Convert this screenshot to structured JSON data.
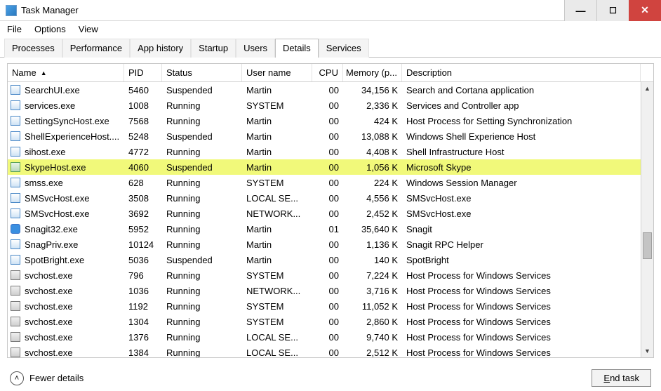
{
  "window": {
    "title": "Task Manager",
    "buttons": {
      "min": "—",
      "max": "☐",
      "close": "✕"
    }
  },
  "menu": {
    "items": [
      "File",
      "Options",
      "View"
    ]
  },
  "tabs": {
    "items": [
      "Processes",
      "Performance",
      "App history",
      "Startup",
      "Users",
      "Details",
      "Services"
    ],
    "active": "Details"
  },
  "columns": {
    "name": "Name",
    "pid": "PID",
    "status": "Status",
    "user": "User name",
    "cpu": "CPU",
    "mem": "Memory (p...",
    "desc": "Description",
    "sort_indicator": "▲"
  },
  "rows": [
    {
      "icon": "app",
      "name": "SearchUI.exe",
      "pid": "5460",
      "status": "Suspended",
      "user": "Martin",
      "cpu": "00",
      "mem": "34,156 K",
      "desc": "Search and Cortana application",
      "hl": false
    },
    {
      "icon": "app",
      "name": "services.exe",
      "pid": "1008",
      "status": "Running",
      "user": "SYSTEM",
      "cpu": "00",
      "mem": "2,336 K",
      "desc": "Services and Controller app",
      "hl": false
    },
    {
      "icon": "app",
      "name": "SettingSyncHost.exe",
      "pid": "7568",
      "status": "Running",
      "user": "Martin",
      "cpu": "00",
      "mem": "424 K",
      "desc": "Host Process for Setting Synchronization",
      "hl": false
    },
    {
      "icon": "app",
      "name": "ShellExperienceHost....",
      "pid": "5248",
      "status": "Suspended",
      "user": "Martin",
      "cpu": "00",
      "mem": "13,088 K",
      "desc": "Windows Shell Experience Host",
      "hl": false
    },
    {
      "icon": "app",
      "name": "sihost.exe",
      "pid": "4772",
      "status": "Running",
      "user": "Martin",
      "cpu": "00",
      "mem": "4,408 K",
      "desc": "Shell Infrastructure Host",
      "hl": false
    },
    {
      "icon": "alt",
      "name": "SkypeHost.exe",
      "pid": "4060",
      "status": "Suspended",
      "user": "Martin",
      "cpu": "00",
      "mem": "1,056 K",
      "desc": "Microsoft Skype",
      "hl": true
    },
    {
      "icon": "app",
      "name": "smss.exe",
      "pid": "628",
      "status": "Running",
      "user": "SYSTEM",
      "cpu": "00",
      "mem": "224 K",
      "desc": "Windows Session Manager",
      "hl": false
    },
    {
      "icon": "app",
      "name": "SMSvcHost.exe",
      "pid": "3508",
      "status": "Running",
      "user": "LOCAL SE...",
      "cpu": "00",
      "mem": "4,556 K",
      "desc": "SMSvcHost.exe",
      "hl": false
    },
    {
      "icon": "app",
      "name": "SMSvcHost.exe",
      "pid": "3692",
      "status": "Running",
      "user": "NETWORK...",
      "cpu": "00",
      "mem": "2,452 K",
      "desc": "SMSvcHost.exe",
      "hl": false
    },
    {
      "icon": "blue",
      "name": "Snagit32.exe",
      "pid": "5952",
      "status": "Running",
      "user": "Martin",
      "cpu": "01",
      "mem": "35,640 K",
      "desc": "Snagit",
      "hl": false
    },
    {
      "icon": "app",
      "name": "SnagPriv.exe",
      "pid": "10124",
      "status": "Running",
      "user": "Martin",
      "cpu": "00",
      "mem": "1,136 K",
      "desc": "Snagit RPC Helper",
      "hl": false
    },
    {
      "icon": "app",
      "name": "SpotBright.exe",
      "pid": "5036",
      "status": "Suspended",
      "user": "Martin",
      "cpu": "00",
      "mem": "140 K",
      "desc": "SpotBright",
      "hl": false
    },
    {
      "icon": "svc",
      "name": "svchost.exe",
      "pid": "796",
      "status": "Running",
      "user": "SYSTEM",
      "cpu": "00",
      "mem": "7,224 K",
      "desc": "Host Process for Windows Services",
      "hl": false
    },
    {
      "icon": "svc",
      "name": "svchost.exe",
      "pid": "1036",
      "status": "Running",
      "user": "NETWORK...",
      "cpu": "00",
      "mem": "3,716 K",
      "desc": "Host Process for Windows Services",
      "hl": false
    },
    {
      "icon": "svc",
      "name": "svchost.exe",
      "pid": "1192",
      "status": "Running",
      "user": "SYSTEM",
      "cpu": "00",
      "mem": "11,052 K",
      "desc": "Host Process for Windows Services",
      "hl": false
    },
    {
      "icon": "svc",
      "name": "svchost.exe",
      "pid": "1304",
      "status": "Running",
      "user": "SYSTEM",
      "cpu": "00",
      "mem": "2,860 K",
      "desc": "Host Process for Windows Services",
      "hl": false
    },
    {
      "icon": "svc",
      "name": "svchost.exe",
      "pid": "1376",
      "status": "Running",
      "user": "LOCAL SE...",
      "cpu": "00",
      "mem": "9,740 K",
      "desc": "Host Process for Windows Services",
      "hl": false
    },
    {
      "icon": "svc",
      "name": "svchost.exe",
      "pid": "1384",
      "status": "Running",
      "user": "LOCAL SE...",
      "cpu": "00",
      "mem": "2,512 K",
      "desc": "Host Process for Windows Services",
      "hl": false
    }
  ],
  "footer": {
    "fewer": "Fewer details",
    "endtask_pre": "E",
    "endtask_rest": "nd task"
  }
}
